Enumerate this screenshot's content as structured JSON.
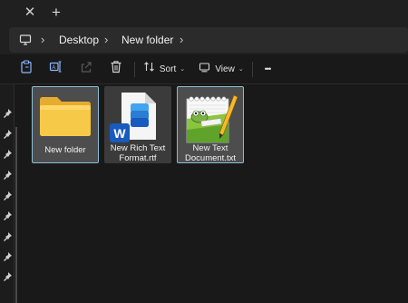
{
  "tabbar": {
    "close_symbol": "✕",
    "new_tab_symbol": "+"
  },
  "address": {
    "crumbs": [
      "Desktop",
      "New folder"
    ],
    "separator": "›",
    "icon": "this-pc-icon"
  },
  "toolbar": {
    "sort_label": "Sort",
    "view_label": "View",
    "more_symbol": "•••",
    "chevron": "⌄",
    "icons": [
      "paste-icon",
      "rename-icon",
      "share-icon",
      "delete-icon",
      "sort-icon",
      "view-icon",
      "more-icon"
    ]
  },
  "items": [
    {
      "label": "New folder",
      "type": "folder",
      "icon": "folder-icon"
    },
    {
      "label": "New Rich Text Format.rtf",
      "line1": "New Rich Text",
      "line2": "Format.rtf",
      "type": "rtf",
      "icon": "word-document-icon"
    },
    {
      "label": "New Text Document.txt",
      "line1": "New Text",
      "line2": "Document.txt",
      "type": "txt",
      "icon": "notepad-plus-plus-icon"
    }
  ],
  "colors": {
    "background": "#191919",
    "chrome": "#202020",
    "address_box": "#2b2b2b",
    "selection_fill": "#4d4d4d",
    "selection_border": "#8cbcd6",
    "folder_yellow": "#f5c44e",
    "word_blue": "#185abd"
  }
}
